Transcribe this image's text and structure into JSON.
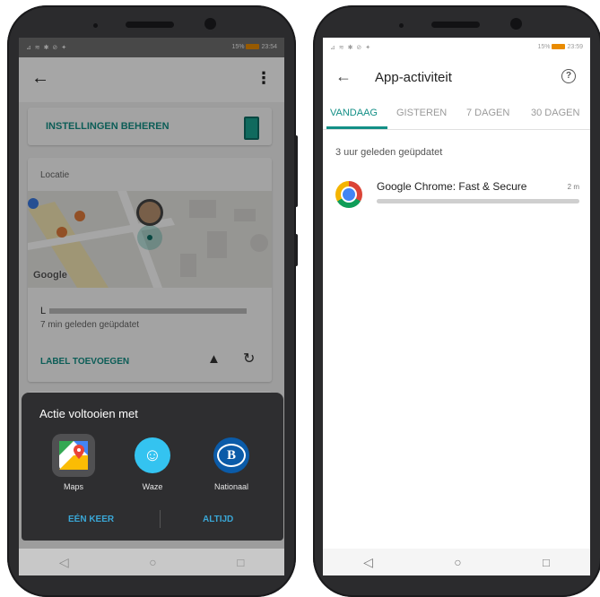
{
  "left_phone": {
    "status": {
      "left_icons": "⊿ ≋ ✱ ⊘ ✦",
      "battery_pct": "15%",
      "time": "23:54"
    },
    "manage_settings_label": "INSTELLINGEN BEHEREN",
    "location_card": {
      "title": "Locatie",
      "address": "L",
      "updated": "7 min geleden geüpdatet",
      "add_label": "LABEL TOEVOEGEN",
      "map_logo": "Google"
    },
    "sheet": {
      "title": "Actie voltooien met",
      "apps": [
        {
          "label": "Maps",
          "icon": "google-maps-icon"
        },
        {
          "label": "Waze",
          "icon": "waze-icon"
        },
        {
          "label": "Nationaal",
          "icon": "nmbs-icon"
        }
      ],
      "once_label": "EÉN KEER",
      "always_label": "ALTIJD"
    }
  },
  "right_phone": {
    "status": {
      "left_icons": "⊿ ≋ ✱ ⊘ ✦",
      "battery_pct": "15%",
      "time": "23:59"
    },
    "title": "App-activiteit",
    "tabs": [
      {
        "label": "VANDAAG",
        "active": true
      },
      {
        "label": "GISTEREN",
        "active": false
      },
      {
        "label": "7 DAGEN",
        "active": false
      },
      {
        "label": "30 DAGEN",
        "active": false
      }
    ],
    "updated": "3 uur geleden geüpdatet",
    "apps": [
      {
        "name": "Google Chrome: Fast & Secure",
        "duration": "2 m",
        "usage_fraction": 1.0
      }
    ]
  },
  "colors": {
    "accent": "#138f86",
    "battery": "#e98b00",
    "sheet_bg": "#2e2e30"
  }
}
